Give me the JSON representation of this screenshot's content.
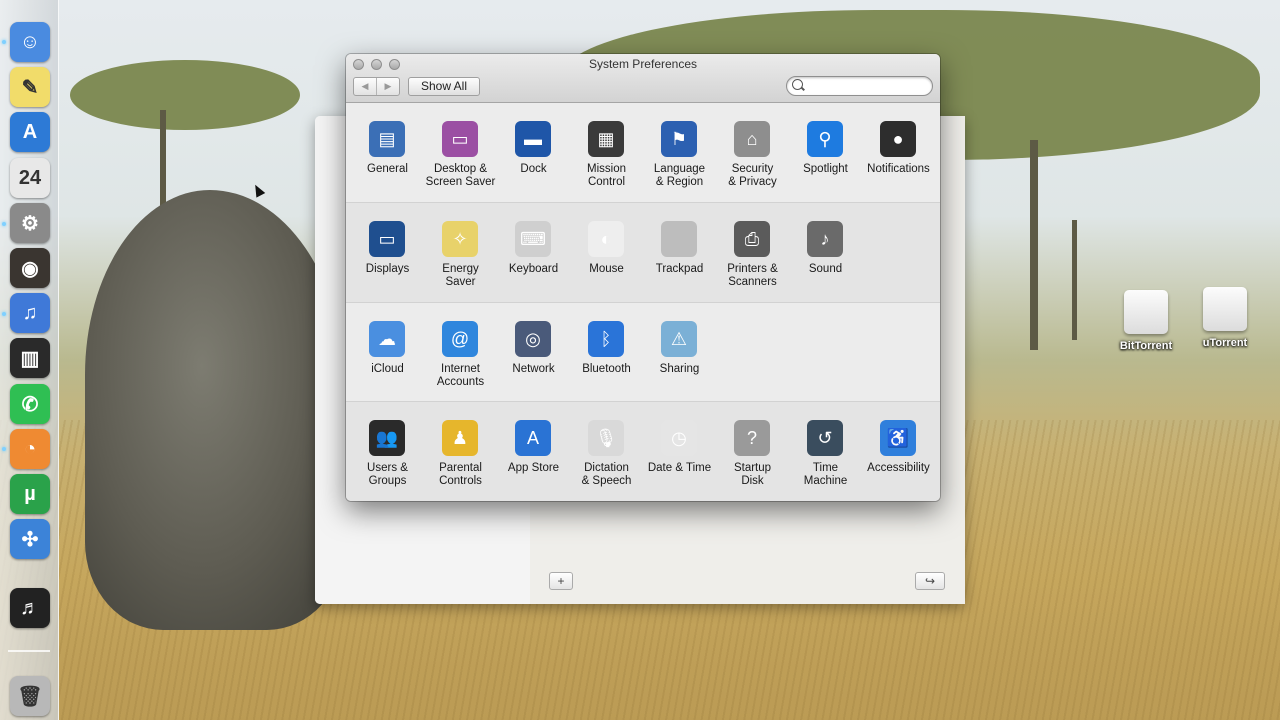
{
  "window": {
    "title": "System Preferences",
    "show_all_label": "Show All",
    "back_glyph": "◀",
    "forward_glyph": "▶",
    "search": {
      "value": "",
      "placeholder": ""
    }
  },
  "rows": [
    [
      {
        "name": "general",
        "label": "General",
        "icon": "general-icon",
        "color": "#3b6fb6",
        "glyph": "▤"
      },
      {
        "name": "desktop-screen-saver",
        "label": "Desktop &\nScreen Saver",
        "icon": "desktop-screen-saver-icon",
        "color": "#9b4fa3",
        "glyph": "▭"
      },
      {
        "name": "dock",
        "label": "Dock",
        "icon": "dock-icon",
        "color": "#1f56a8",
        "glyph": "▬"
      },
      {
        "name": "mission-control",
        "label": "Mission\nControl",
        "icon": "mission-control-icon",
        "color": "#3a3a3a",
        "glyph": "▦"
      },
      {
        "name": "language-region",
        "label": "Language\n& Region",
        "icon": "language-region-icon",
        "color": "#2c60b1",
        "glyph": "⚑"
      },
      {
        "name": "security-privacy",
        "label": "Security\n& Privacy",
        "icon": "security-privacy-icon",
        "color": "#8e8e8e",
        "glyph": "⌂"
      },
      {
        "name": "spotlight",
        "label": "Spotlight",
        "icon": "spotlight-icon",
        "color": "#1e7be0",
        "glyph": "⚲"
      },
      {
        "name": "notifications",
        "label": "Notifications",
        "icon": "notifications-icon",
        "color": "#2d2d2d",
        "glyph": "●"
      }
    ],
    [
      {
        "name": "displays",
        "label": "Displays",
        "icon": "displays-icon",
        "color": "#1f4f8f",
        "glyph": "▭"
      },
      {
        "name": "energy-saver",
        "label": "Energy\nSaver",
        "icon": "energy-saver-icon",
        "color": "#e8d26a",
        "glyph": "✧"
      },
      {
        "name": "keyboard",
        "label": "Keyboard",
        "icon": "keyboard-icon",
        "color": "#cfcfcf",
        "glyph": "⌨"
      },
      {
        "name": "mouse",
        "label": "Mouse",
        "icon": "mouse-icon",
        "color": "#eeeeee",
        "glyph": "◐"
      },
      {
        "name": "trackpad",
        "label": "Trackpad",
        "icon": "trackpad-icon",
        "color": "#bdbdbd",
        "glyph": ""
      },
      {
        "name": "printers-scanners",
        "label": "Printers &\nScanners",
        "icon": "printer-icon",
        "color": "#5b5b5b",
        "glyph": "⎙"
      },
      {
        "name": "sound",
        "label": "Sound",
        "icon": "sound-icon",
        "color": "#6a6a6a",
        "glyph": "♪"
      }
    ],
    [
      {
        "name": "icloud",
        "label": "iCloud",
        "icon": "icloud-icon",
        "color": "#4a8fe0",
        "glyph": "☁"
      },
      {
        "name": "internet-accounts",
        "label": "Internet\nAccounts",
        "icon": "internet-accounts-icon",
        "color": "#2f86dd",
        "glyph": "@"
      },
      {
        "name": "network",
        "label": "Network",
        "icon": "network-icon",
        "color": "#4a5a7a",
        "glyph": "◎"
      },
      {
        "name": "bluetooth",
        "label": "Bluetooth",
        "icon": "bluetooth-icon",
        "color": "#2a74d8",
        "glyph": "ᛒ"
      },
      {
        "name": "sharing",
        "label": "Sharing",
        "icon": "sharing-icon",
        "color": "#7bb0d6",
        "glyph": "⚠"
      }
    ],
    [
      {
        "name": "users-groups",
        "label": "Users &\nGroups",
        "icon": "users-groups-icon",
        "color": "#2a2a2a",
        "glyph": "👥"
      },
      {
        "name": "parental-controls",
        "label": "Parental\nControls",
        "icon": "parental-controls-icon",
        "color": "#e6b62c",
        "glyph": "♟"
      },
      {
        "name": "app-store",
        "label": "App Store",
        "icon": "app-store-icon",
        "color": "#2a73d4",
        "glyph": "A"
      },
      {
        "name": "dictation-speech",
        "label": "Dictation\n& Speech",
        "icon": "dictation-speech-icon",
        "color": "#d9d9d9",
        "glyph": "🎙"
      },
      {
        "name": "date-time",
        "label": "Date & Time",
        "icon": "date-time-icon",
        "color": "#e5e5e5",
        "glyph": "◷"
      },
      {
        "name": "startup-disk",
        "label": "Startup\nDisk",
        "icon": "startup-disk-icon",
        "color": "#9a9a9a",
        "glyph": "?"
      },
      {
        "name": "time-machine",
        "label": "Time\nMachine",
        "icon": "time-machine-icon",
        "color": "#3a4d5e",
        "glyph": "↺"
      },
      {
        "name": "accessibility",
        "label": "Accessibility",
        "icon": "accessibility-icon",
        "color": "#2f7fdc",
        "glyph": "♿"
      }
    ]
  ],
  "desktop": {
    "drives": [
      {
        "name": "bittorrent",
        "label": "BitTorrent"
      },
      {
        "name": "utorrent",
        "label": "uTorrent"
      }
    ]
  },
  "dock": {
    "items": [
      {
        "name": "finder",
        "color": "#4a8be0",
        "glyph": "☺"
      },
      {
        "name": "stickies",
        "color": "#f1dc6a",
        "glyph": "✎"
      },
      {
        "name": "app-store",
        "color": "#2d7ad6",
        "glyph": "A"
      },
      {
        "name": "calendar",
        "color": "#e8e8e8",
        "glyph": "24"
      },
      {
        "name": "system-preferences",
        "color": "#8a8a8a",
        "glyph": "⚙"
      },
      {
        "name": "photo-booth",
        "color": "#3a3530",
        "glyph": "◉"
      },
      {
        "name": "itunes",
        "color": "#3f79d8",
        "glyph": "♫"
      },
      {
        "name": "piano",
        "color": "#2a2a2a",
        "glyph": "▥"
      },
      {
        "name": "whatsapp",
        "color": "#2fbf53",
        "glyph": "✆"
      },
      {
        "name": "app-free",
        "color": "#ef8a32",
        "glyph": "◔"
      },
      {
        "name": "utorrent",
        "color": "#2aa24a",
        "glyph": "µ"
      },
      {
        "name": "safari",
        "color": "#3c83d8",
        "glyph": "✣"
      },
      {
        "name": "music",
        "color": "#222222",
        "glyph": "♬"
      },
      {
        "name": "trash",
        "color": "#b8b8b8",
        "glyph": "🗑"
      }
    ]
  },
  "background_window": {
    "add_label": "+",
    "share_label": "↪"
  }
}
